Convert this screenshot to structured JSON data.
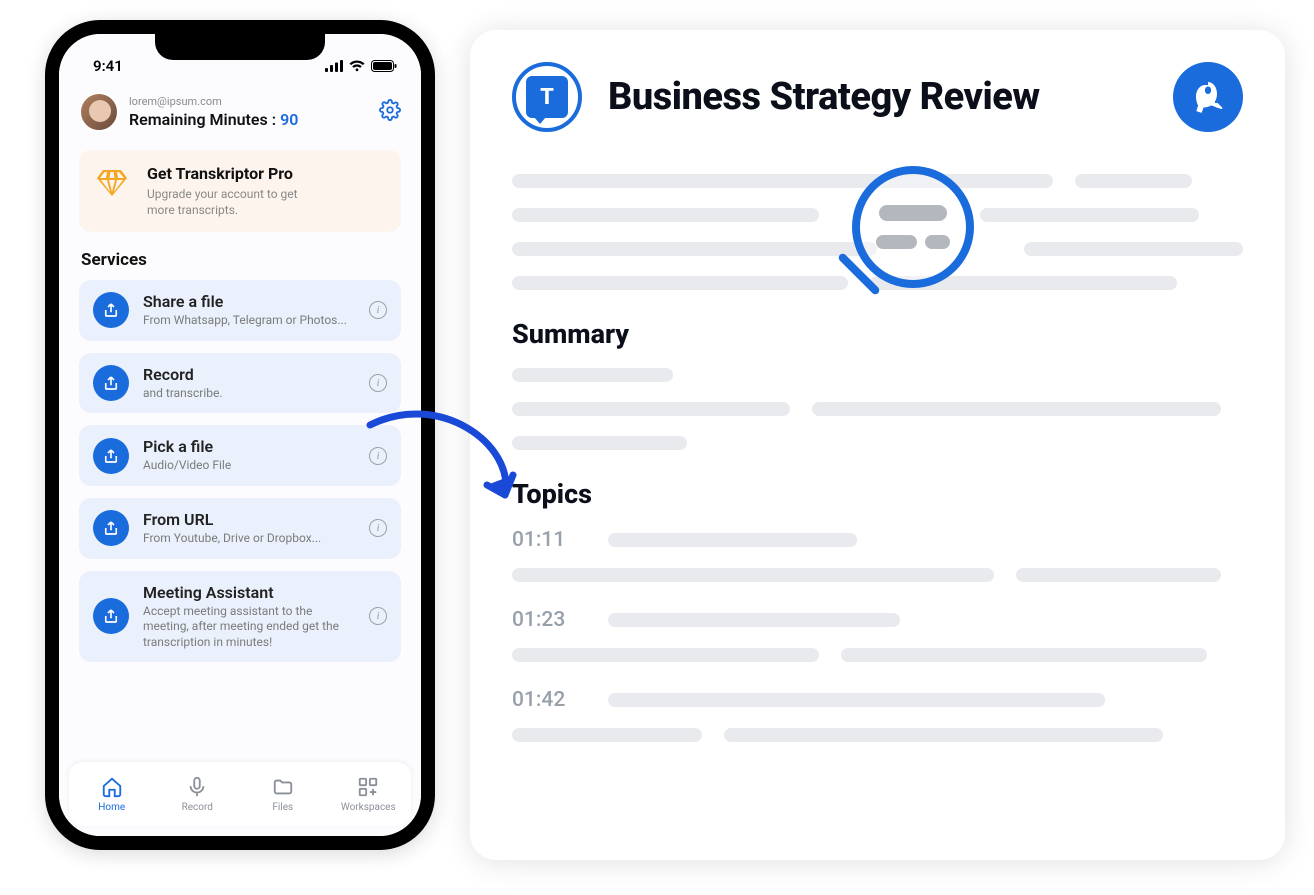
{
  "phone": {
    "statusbar": {
      "time": "9:41"
    },
    "profile": {
      "email": "lorem@ipsum.com",
      "remaining_label": "Remaining Minutes :",
      "remaining_value": "90"
    },
    "pro_card": {
      "title": "Get Transkriptor Pro",
      "subtitle": "Upgrade your account to get more transcripts."
    },
    "services_heading": "Services",
    "services": [
      {
        "title": "Share a file",
        "subtitle": "From Whatsapp, Telegram or Photos..."
      },
      {
        "title": "Record",
        "subtitle": "and transcribe."
      },
      {
        "title": "Pick a file",
        "subtitle": "Audio/Video File"
      },
      {
        "title": "From URL",
        "subtitle": "From Youtube, Drive or Dropbox..."
      },
      {
        "title": "Meeting Assistant",
        "subtitle": "Accept meeting assistant to the meeting, after meeting ended get the transcription in minutes!"
      }
    ],
    "tabs": [
      {
        "label": "Home"
      },
      {
        "label": "Record"
      },
      {
        "label": "Files"
      },
      {
        "label": "Workspaces"
      }
    ]
  },
  "card": {
    "title": "Business Strategy Review",
    "summary_heading": "Summary",
    "topics_heading": "Topics",
    "topics": [
      {
        "time": "01:11"
      },
      {
        "time": "01:23"
      },
      {
        "time": "01:42"
      }
    ]
  }
}
